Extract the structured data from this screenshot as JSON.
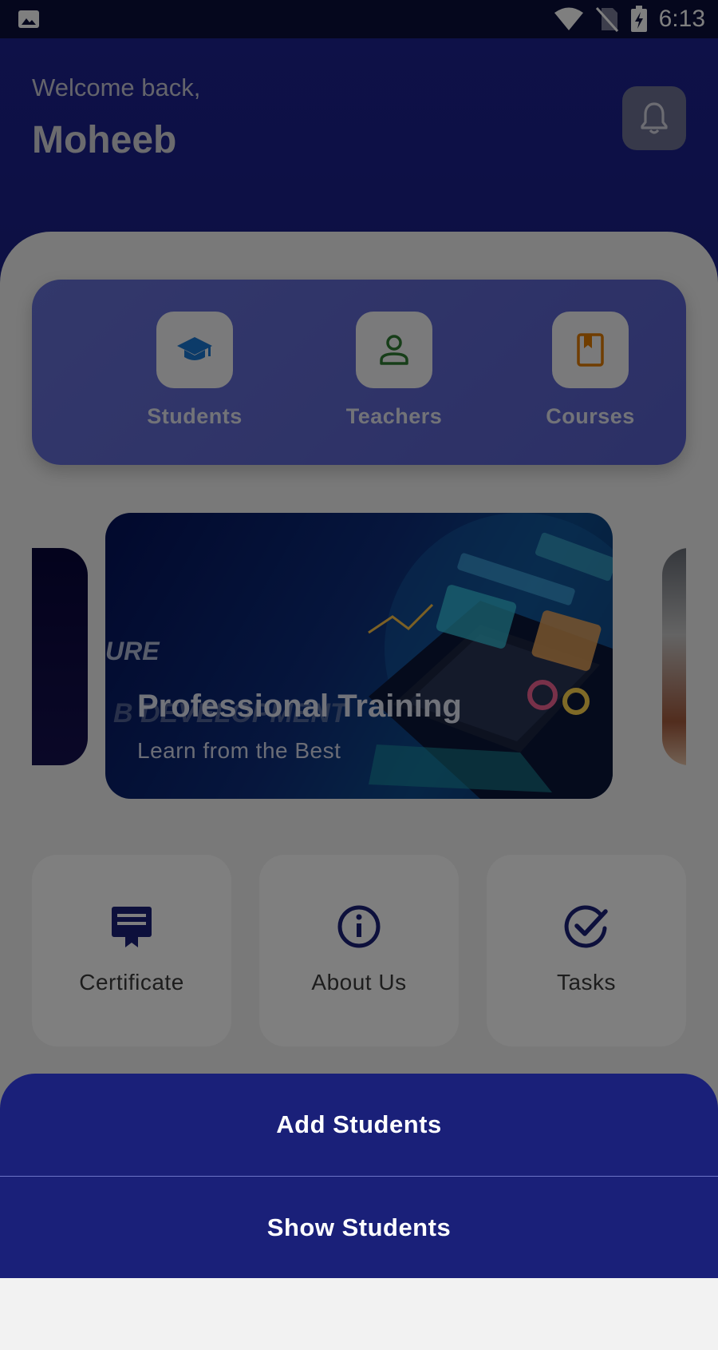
{
  "status_bar": {
    "time": "6:13"
  },
  "header": {
    "greeting": "Welcome back,",
    "user_name": "Moheeb"
  },
  "stats": [
    {
      "label": "Students",
      "icon": "graduation-cap-icon",
      "color": "#1976d2"
    },
    {
      "label": "Teachers",
      "icon": "person-icon",
      "color": "#2e7d32"
    },
    {
      "label": "Courses",
      "icon": "book-icon",
      "color": "#e07a00"
    }
  ],
  "carousel": {
    "title": "Professional Training",
    "subtitle": "Learn from the Best",
    "overlay_text_1": "URE",
    "overlay_text_2": "B DEVELOPMENT"
  },
  "features": [
    {
      "label": "Certificate",
      "icon": "certificate-icon"
    },
    {
      "label": "About Us",
      "icon": "info-icon"
    },
    {
      "label": "Tasks",
      "icon": "check-circle-icon"
    }
  ],
  "action_sheet": {
    "add_label": "Add Students",
    "show_label": "Show Students"
  },
  "colors": {
    "primary": "#1a2079",
    "accent_card": "#5f68d6",
    "background": "#f2f2f2"
  }
}
